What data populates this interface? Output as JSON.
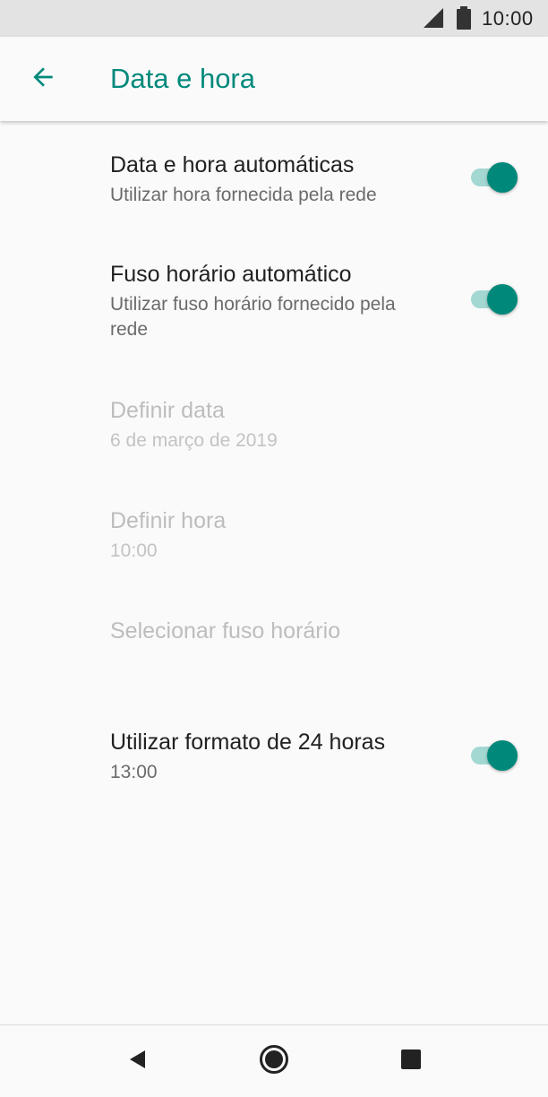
{
  "status_bar": {
    "time": "10:00",
    "icons": [
      "signal-icon",
      "battery-icon"
    ]
  },
  "app_bar": {
    "back_icon": "arrow-left-icon",
    "title": "Data e hora"
  },
  "settings": [
    {
      "label": "Data e hora automáticas",
      "summary": "Utilizar hora fornecida pela rede",
      "enabled": true,
      "toggle": true
    },
    {
      "label": "Fuso horário automático",
      "summary": "Utilizar fuso horário fornecido pela rede",
      "enabled": true,
      "toggle": true
    },
    {
      "label": "Definir data",
      "summary": "6 de março de 2019",
      "enabled": false
    },
    {
      "label": "Definir hora",
      "summary": "10:00",
      "enabled": false
    },
    {
      "label": "Selecionar fuso horário",
      "enabled": false
    },
    {
      "label": "Utilizar formato de 24 horas",
      "summary": "13:00",
      "enabled": true,
      "toggle": true
    }
  ],
  "nav_bar": {
    "icons": [
      "back-triangle-icon",
      "home-circle-icon",
      "recents-square-icon"
    ]
  },
  "colors": {
    "accent": "#00897b",
    "toggle_track": "#a3d8d2",
    "status_bar_bg": "#e3e3e3",
    "background": "#fafafa"
  }
}
